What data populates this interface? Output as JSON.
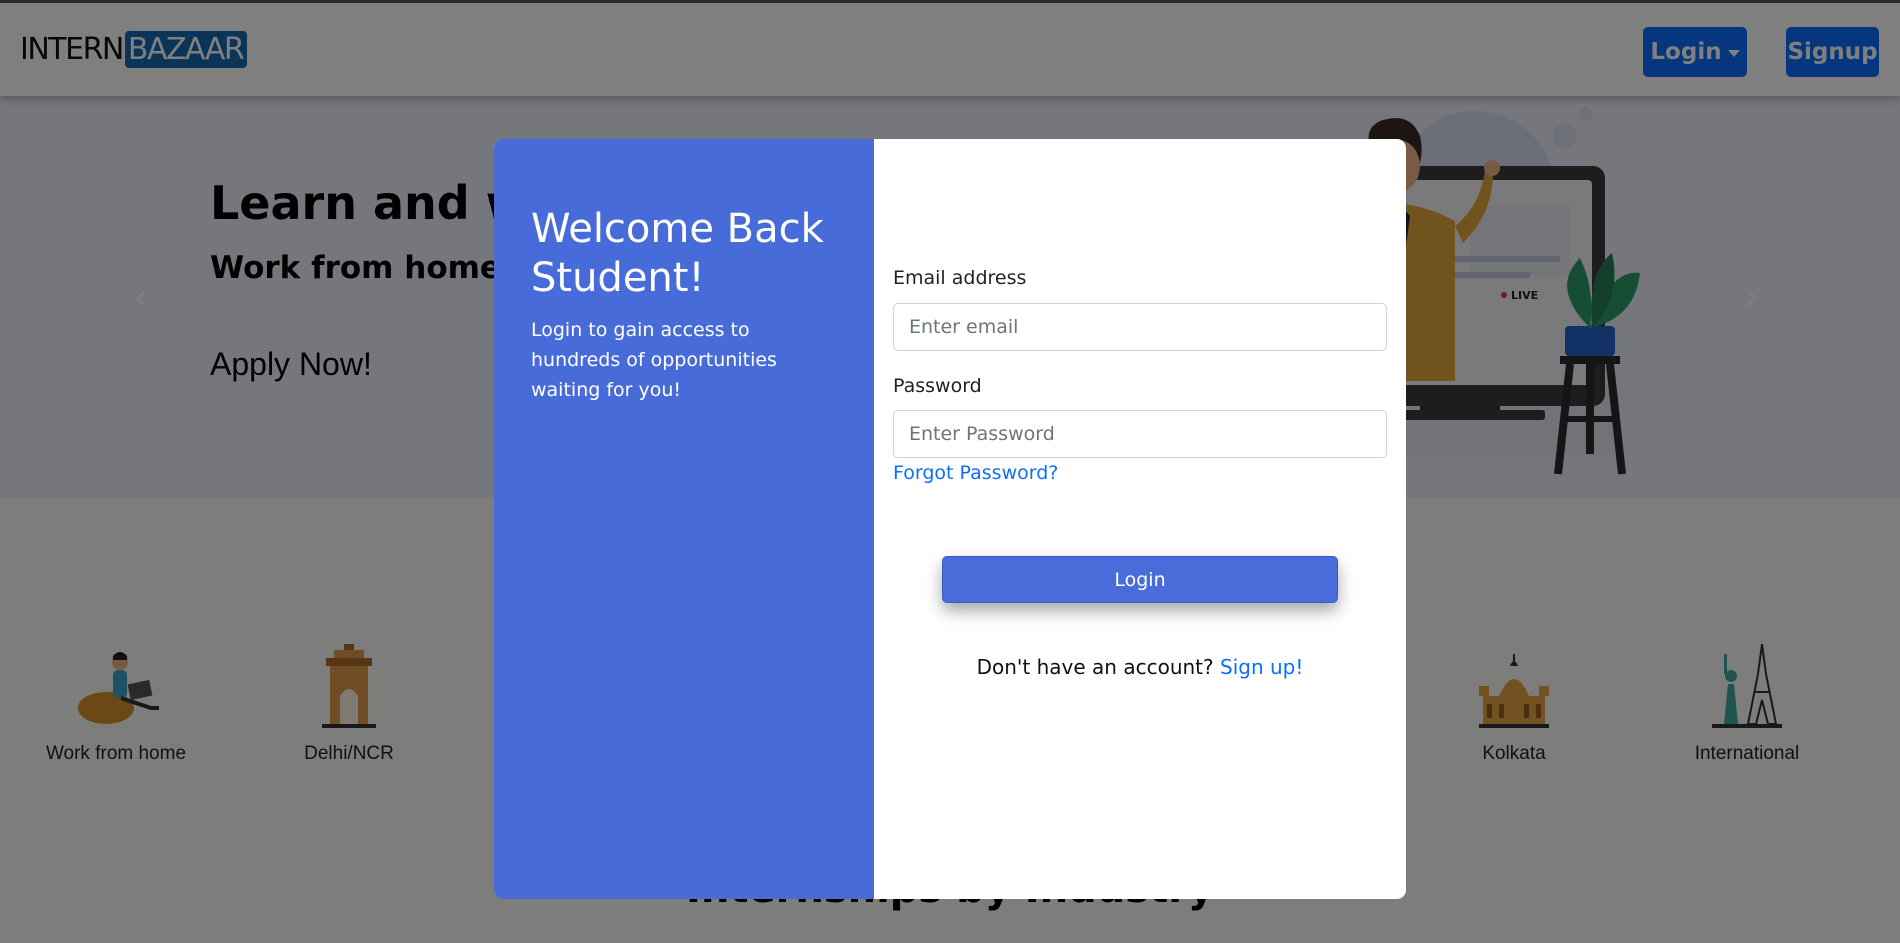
{
  "navbar": {
    "logo_part1": "INTERN",
    "logo_part2": "BAZAAR",
    "login_label": "Login",
    "signup_label": "Signup"
  },
  "hero": {
    "title": "Learn and work",
    "subtitle": "Work from home or",
    "apply": "Apply Now!",
    "live_badge": "LIVE"
  },
  "locations": [
    {
      "label": "Work from home",
      "icon": "work-from-home-icon"
    },
    {
      "label": "Delhi/NCR",
      "icon": "india-gate-icon"
    },
    {
      "label": "Kolkata",
      "icon": "victoria-memorial-icon"
    },
    {
      "label": "International",
      "icon": "statue-of-liberty-eiffel-icon"
    }
  ],
  "industry_heading": "Internships by Industry",
  "modal": {
    "welcome_title": "Welcome Back Student!",
    "welcome_text": "Login to gain access to hundreds of opportunities waiting for you!",
    "email_label": "Email address",
    "email_placeholder": "Enter email",
    "email_value": "",
    "password_label": "Password",
    "password_placeholder": "Enter Password",
    "password_value": "",
    "forgot_link": "Forgot Password?",
    "login_button": "Login",
    "signup_prompt": "Don't have an account?",
    "signup_link": "Sign up!"
  },
  "colors": {
    "primary_blue": "#0d6efd",
    "modal_panel": "#476cd9",
    "logo_blue": "#1769b3"
  }
}
